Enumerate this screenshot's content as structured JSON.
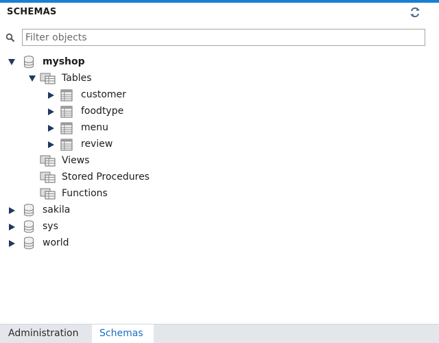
{
  "header": {
    "title": "SCHEMAS",
    "refresh_icon": "refresh-icon"
  },
  "filter": {
    "placeholder": "Filter objects",
    "value": "",
    "icon": "search-icon"
  },
  "tree": {
    "schemas": [
      {
        "name": "myshop",
        "expanded": true,
        "active": true,
        "groups": [
          {
            "name": "Tables",
            "expanded": true,
            "items": [
              "customer",
              "foodtype",
              "menu",
              "review"
            ]
          },
          {
            "name": "Views",
            "expanded": false
          },
          {
            "name": "Stored Procedures",
            "expanded": false
          },
          {
            "name": "Functions",
            "expanded": false
          }
        ]
      },
      {
        "name": "sakila",
        "expanded": false
      },
      {
        "name": "sys",
        "expanded": false
      },
      {
        "name": "world",
        "expanded": false
      }
    ]
  },
  "tabs": [
    {
      "label": "Administration",
      "active": false
    },
    {
      "label": "Schemas",
      "active": true
    }
  ],
  "colors": {
    "accent": "#1a7fd4",
    "tab_active_text": "#1a6fc2",
    "arrow": "#1f3a5f"
  }
}
